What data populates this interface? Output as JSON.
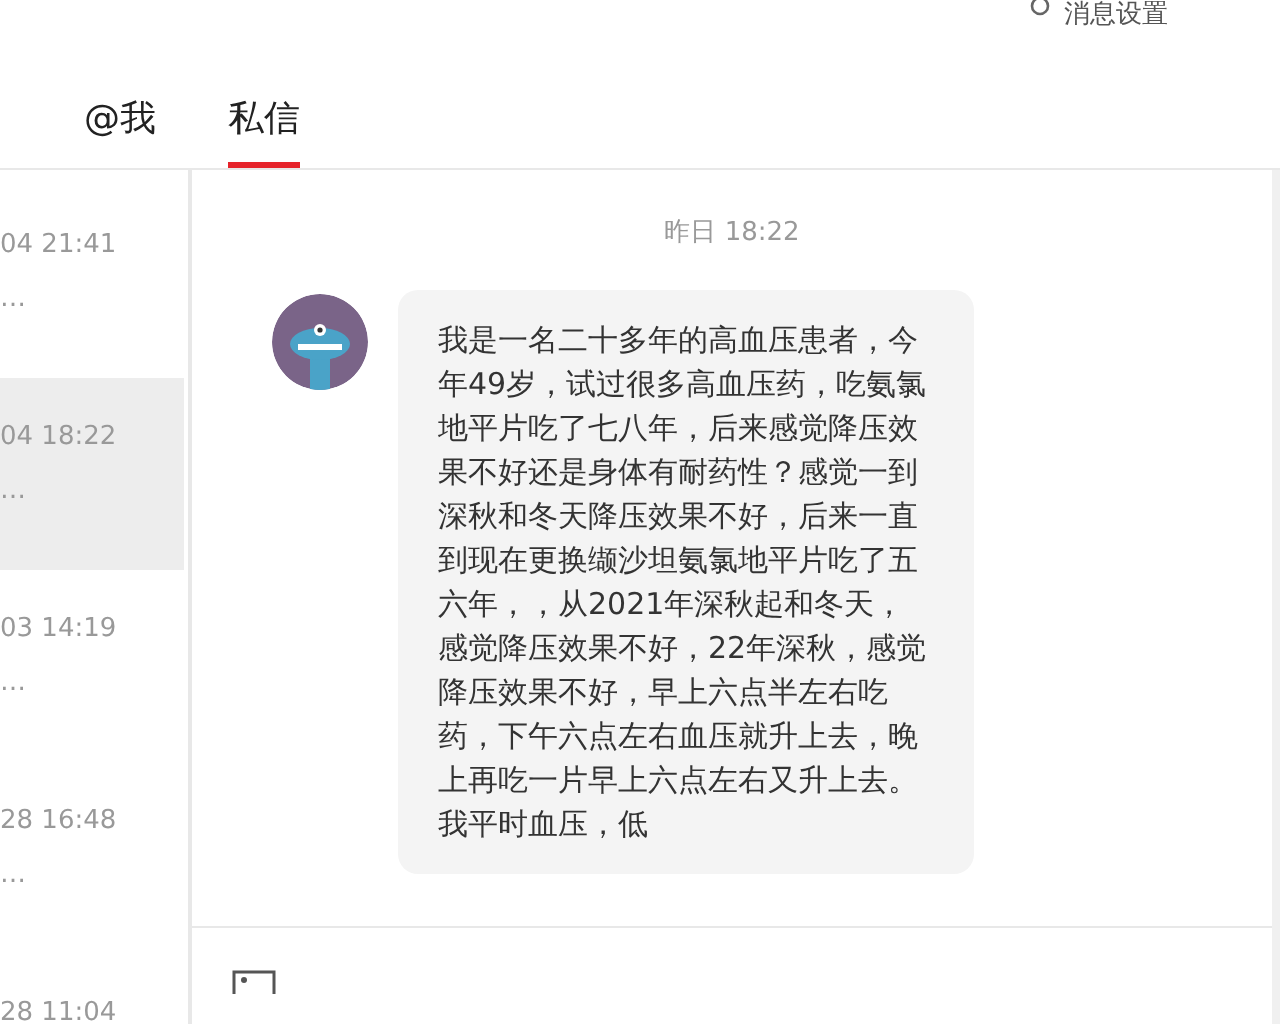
{
  "settings_link": {
    "label": "消息设置"
  },
  "tabs": [
    {
      "label": "@我",
      "selected": false
    },
    {
      "label": "私信",
      "selected": true
    }
  ],
  "conversations": [
    {
      "time": "04 21:41",
      "preview": "…",
      "selected": false
    },
    {
      "time": "04 18:22",
      "preview": "…",
      "selected": true
    },
    {
      "time": "03 14:19",
      "preview": "…",
      "selected": false
    },
    {
      "time": "28 16:48",
      "preview": "…",
      "selected": false
    },
    {
      "time": "28 11:04",
      "selected": false
    }
  ],
  "chat": {
    "timestamp": "昨日 18:22",
    "messages": [
      {
        "text": "我是一名二十多年的高血压患者，今年49岁，试过很多高血压药，吃氨氯地平片吃了七八年，后来感觉降压效果不好还是身体有耐药性？感觉一到深秋和冬天降压效果不好，后来一直到现在更换缬沙坦氨氯地平片吃了五六年，，从2021年深秋起和冬天，感觉降压效果不好，22年深秋，感觉降压效果不好，早上六点半左右吃药，下午六点左右血压就升上去，晚上再吃一片早上六点左右又升上去。我平时血压，低"
      }
    ]
  }
}
